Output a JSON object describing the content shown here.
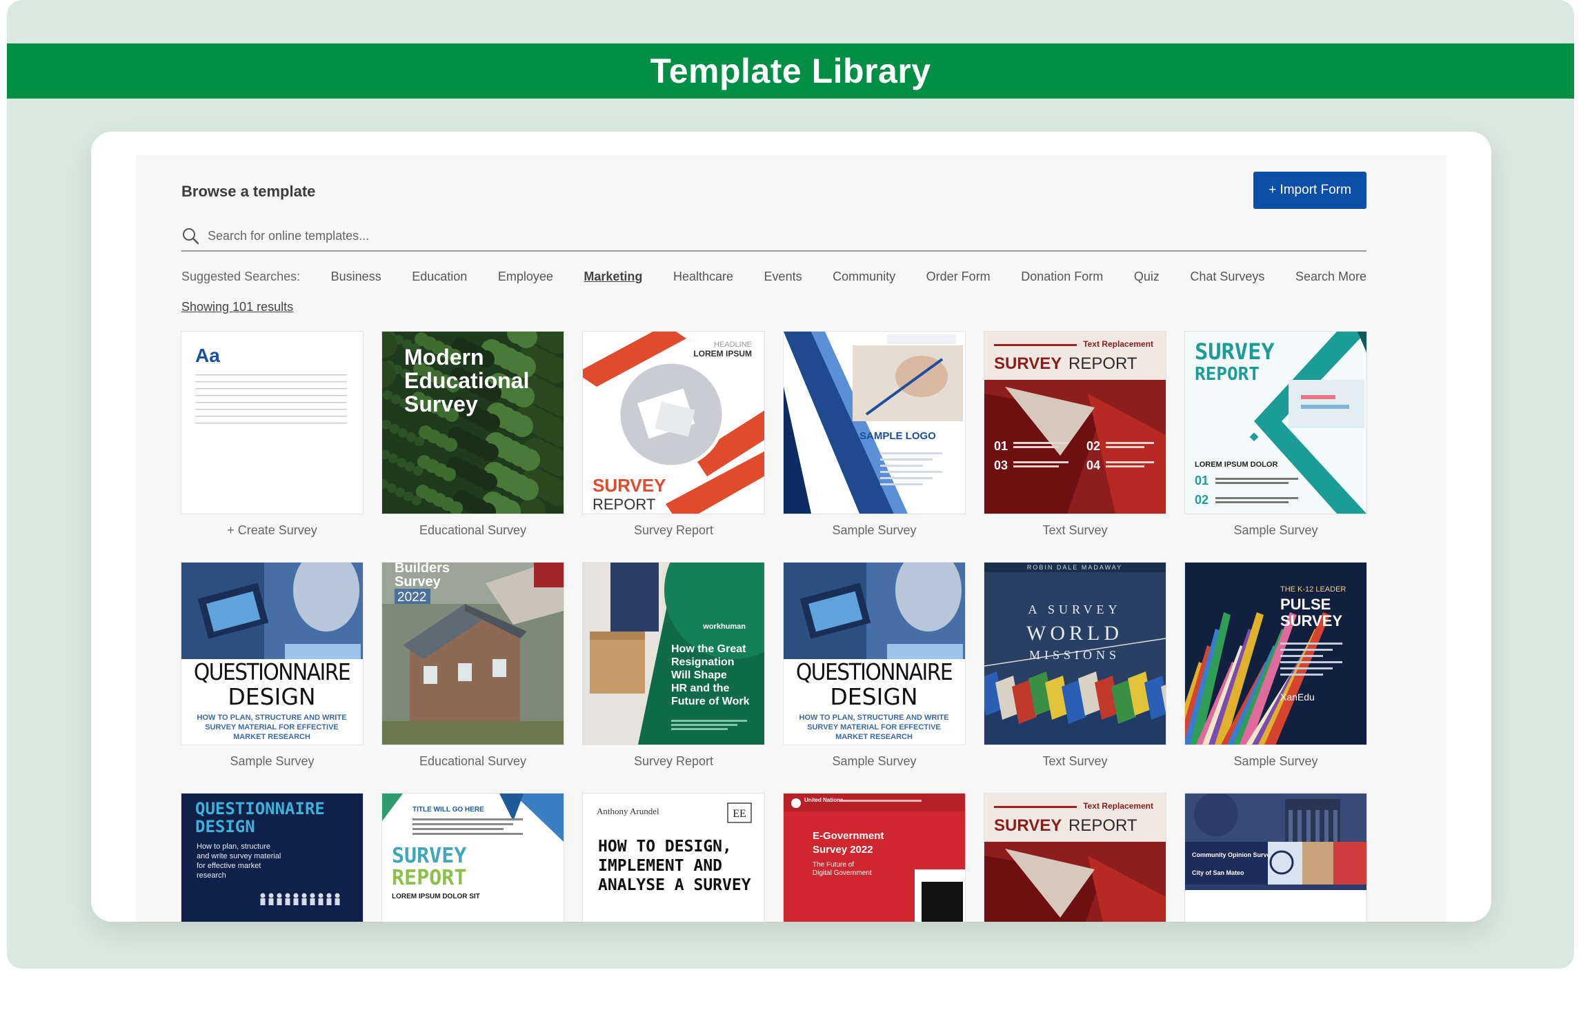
{
  "header": {
    "title": "Template Library"
  },
  "browse": {
    "title": "Browse a template",
    "import_label": "+ Import Form",
    "search_placeholder": "Search for online templates...",
    "suggested_label": "Suggested Searches:",
    "suggested": [
      "Business",
      "Education",
      "Employee",
      "Marketing",
      "Healthcare",
      "Events",
      "Community",
      "Order Form",
      "Donation Form",
      "Quiz",
      "Chat Surveys",
      "Search More"
    ],
    "active_suggestion": "Marketing",
    "results_text": "Showing 101 results"
  },
  "colors": {
    "banner": "#008f45",
    "import_button": "#0c4fa8",
    "background": "#d9e8e1"
  },
  "tiles": [
    {
      "caption": "+ Create Survey",
      "thumb": {
        "kind": "blank",
        "text": "Aa"
      }
    },
    {
      "caption": "Educational Survey",
      "thumb": {
        "kind": "forest",
        "lines": [
          "Modern",
          "Educational",
          "Survey"
        ]
      }
    },
    {
      "caption": "Survey Report",
      "thumb": {
        "kind": "red-circle",
        "t1": "HEADLINE",
        "t2": "LOREM IPSUM",
        "t3": "SURVEY",
        "t4": "REPORT"
      }
    },
    {
      "caption": "Sample Survey",
      "thumb": {
        "kind": "blue-diag",
        "t1": "SAMPLE LOGO"
      }
    },
    {
      "caption": "Text Survey",
      "thumb": {
        "kind": "maroon",
        "t0": "Text Replacement",
        "t1": "SURVEY",
        "t2": "REPORT",
        "n1": "01",
        "n2": "02",
        "n3": "03",
        "n4": "04"
      }
    },
    {
      "caption": "Sample Survey",
      "thumb": {
        "kind": "teal",
        "t1": "SURVEY",
        "t2": "REPORT",
        "t3": "LOREM IPSUM DOLOR",
        "n1": "01",
        "n2": "02"
      }
    },
    {
      "caption": "Sample Survey",
      "thumb": {
        "kind": "questionnaire",
        "t1": "QUESTIONNAIRE",
        "t2": "DESIGN",
        "t3": "HOW TO PLAN, STRUCTURE AND WRITE",
        "t4": "SURVEY MATERIAL FOR EFFECTIVE",
        "t5": "MARKET RESEARCH"
      }
    },
    {
      "caption": "Educational Survey",
      "thumb": {
        "kind": "houses",
        "t1": "Builders",
        "t2": "Survey",
        "t3": "2022"
      }
    },
    {
      "caption": "Survey Report",
      "thumb": {
        "kind": "green-box",
        "t0": "workhuman",
        "lines": [
          "How the Great",
          "Resignation",
          "Will Shape",
          "HR and the",
          "Future of Work"
        ]
      }
    },
    {
      "caption": "Sample Survey",
      "thumb": {
        "kind": "questionnaire",
        "t1": "QUESTIONNAIRE",
        "t2": "DESIGN",
        "t3": "HOW TO PLAN, STRUCTURE AND WRITE",
        "t4": "SURVEY MATERIAL FOR EFFECTIVE",
        "t5": "MARKET RESEARCH"
      }
    },
    {
      "caption": "Text Survey",
      "thumb": {
        "kind": "flags",
        "t0": "ROBIN DALE MADAWAY",
        "t1": "A SURVEY",
        "t2": "WORLD",
        "t3": "MISSIONS"
      }
    },
    {
      "caption": "Sample Survey",
      "thumb": {
        "kind": "pencils",
        "t0": "THE K-12 LEADER",
        "t1": "PULSE",
        "t2": "SURVEY",
        "t3": "XanEdu"
      }
    },
    {
      "caption": "",
      "thumb": {
        "kind": "navy-q",
        "t1": "QUESTIONNAIRE",
        "t2": "DESIGN",
        "lines": [
          "How to plan, structure",
          "and write survey material",
          "for effective market",
          "research"
        ]
      }
    },
    {
      "caption": "",
      "thumb": {
        "kind": "teal-report",
        "t0": "TITLE WILL GO HERE",
        "t1": "SURVEY",
        "t2": "REPORT",
        "t3": "LOREM IPSUM DOLOR SIT"
      }
    },
    {
      "caption": "",
      "thumb": {
        "kind": "book",
        "t0": "Anthony Arundel",
        "t1": "HOW TO DESIGN,",
        "t2": "IMPLEMENT AND",
        "t3": "ANALYSE A SURVEY"
      }
    },
    {
      "caption": "",
      "thumb": {
        "kind": "red-un",
        "t0": "United Nations",
        "t1": "E-Government",
        "t2": "Survey 2022",
        "t3": "The Future of",
        "t4": "Digital Government"
      }
    },
    {
      "caption": "",
      "thumb": {
        "kind": "maroon",
        "t0": "Text Replacement",
        "t1": "SURVEY",
        "t2": "REPORT",
        "n1": "",
        "n2": "",
        "n3": "",
        "n4": ""
      }
    },
    {
      "caption": "",
      "thumb": {
        "kind": "civic",
        "t1": "Community Opinion Survey",
        "t2": "City of San Mateo"
      }
    }
  ]
}
